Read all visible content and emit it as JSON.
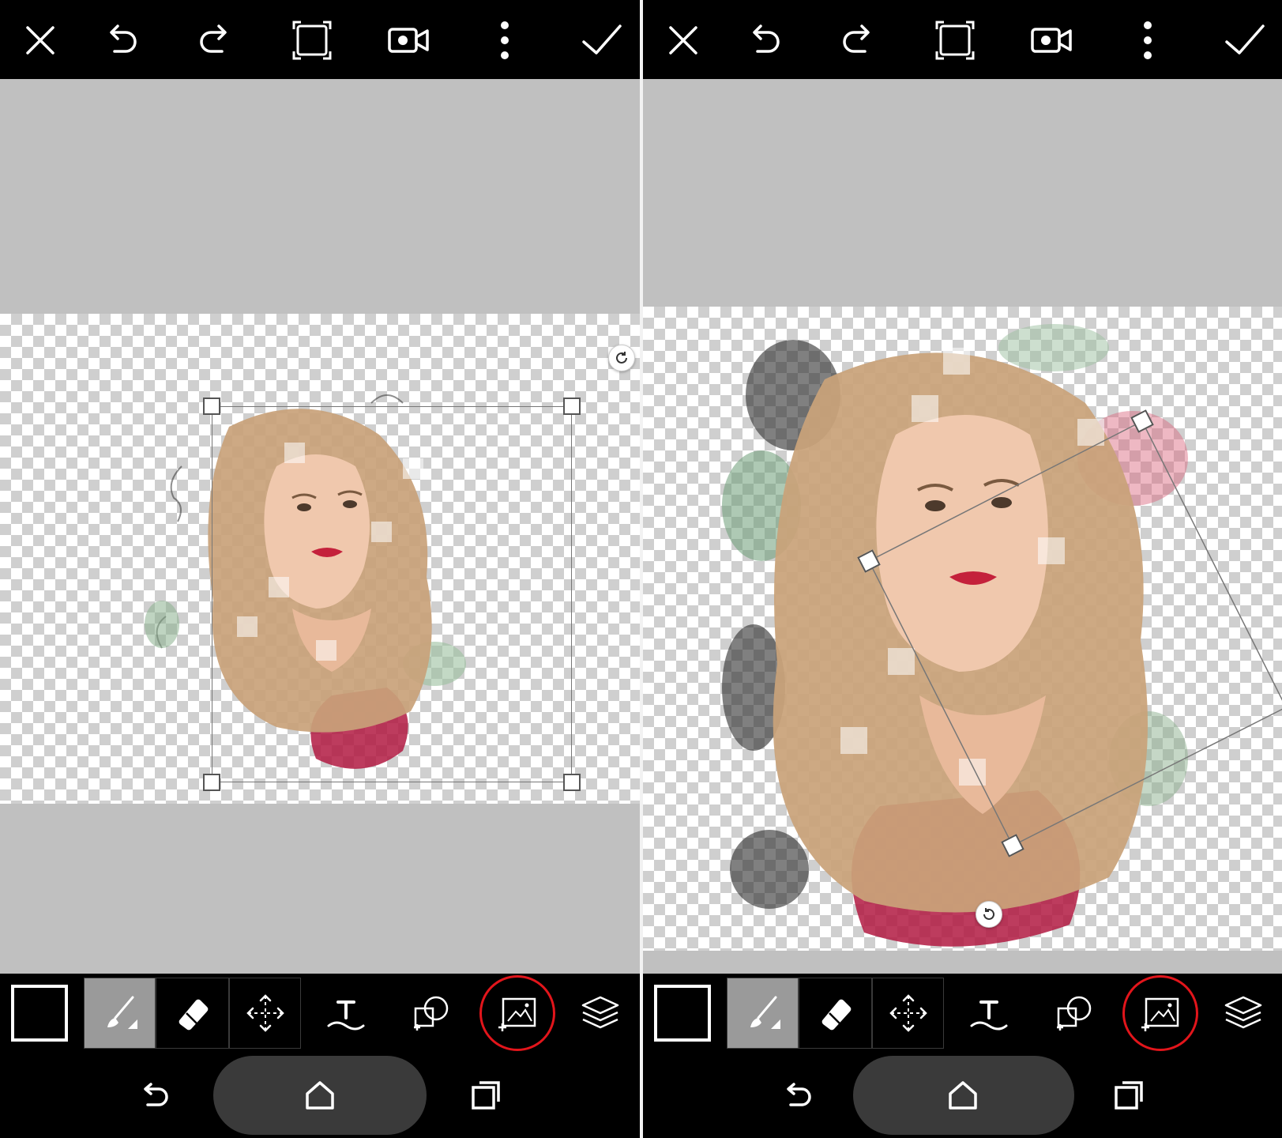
{
  "left_panel": {
    "topbar": [
      "close-icon",
      "undo-icon",
      "redo-icon",
      "crop-frame-icon",
      "video-record-icon",
      "more-vertical-icon",
      "check-icon"
    ],
    "toolbar": [
      "color-swatch",
      "brush-icon",
      "eraser-icon",
      "move-icon",
      "text-icon",
      "shape-add-icon",
      "add-photo-icon",
      "layers-icon"
    ],
    "selected_tool": "brush-icon",
    "highlighted_tool": "add-photo-icon"
  },
  "right_panel": {
    "topbar": [
      "close-icon",
      "undo-icon",
      "redo-icon",
      "crop-frame-icon",
      "video-record-icon",
      "more-vertical-icon",
      "check-icon"
    ],
    "toolbar": [
      "color-swatch",
      "brush-icon",
      "eraser-icon",
      "move-icon",
      "text-icon",
      "shape-add-icon",
      "add-photo-icon",
      "layers-icon"
    ],
    "selected_tool": "brush-icon",
    "highlighted_tool": "add-photo-icon"
  },
  "navbar": [
    "back-icon",
    "home-icon",
    "recents-icon"
  ],
  "colors": {
    "bar": "#000000",
    "canvas_bg": "#c0c0c0",
    "highlight_ring": "#e2151b",
    "selected_tool_bg": "#9a9a9a",
    "lips": "#c4213b",
    "dress": "#b11a42",
    "hair": "#c9a27a"
  }
}
